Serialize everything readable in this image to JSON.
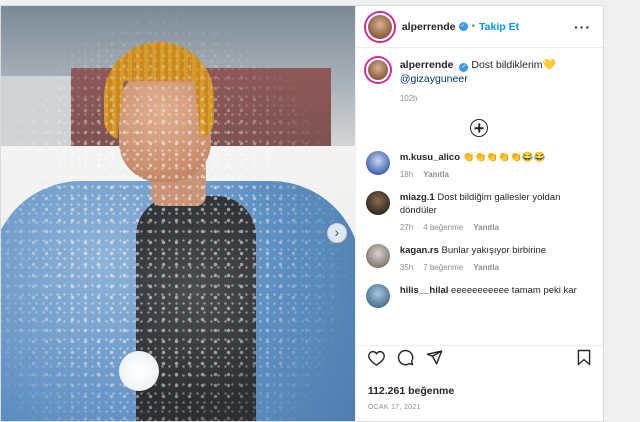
{
  "header": {
    "username": "alperrende",
    "follow_label": "Takip Et"
  },
  "caption": {
    "username": "alperrende",
    "text": "Dost bildiklerim💛",
    "mention": "@gizayguneer",
    "time": "102h"
  },
  "comments": [
    {
      "username": "m.kusu_alico",
      "text": "👏👏👏👏👏😂😂",
      "time": "18h",
      "likes": "",
      "reply": "Yanıtla"
    },
    {
      "username": "miazg.1",
      "text": "Dost bildiğim gallesler yoldan döndüler",
      "time": "27h",
      "likes": "4 beğenme",
      "reply": "Yanıtla"
    },
    {
      "username": "kagan.rs",
      "text": "Bunlar yakışıyor birbirine",
      "time": "35h",
      "likes": "7 beğenme",
      "reply": "Yanıtla"
    },
    {
      "username": "hilis__hilal",
      "text": "eeeeeeeeeee tamam peki kar",
      "time": "",
      "likes": "",
      "reply": ""
    }
  ],
  "likes": "112.261 beğenme",
  "date": "OCAK 17, 2021",
  "icons": {
    "next": "chevron-right-icon",
    "add": "plus-circle-icon",
    "like": "heart-icon",
    "comment": "comment-icon",
    "share": "paper-plane-icon",
    "save": "bookmark-icon",
    "verified": "verified-badge-icon",
    "more": "ellipsis-icon"
  },
  "colors": {
    "accent": "#0095f6",
    "verified": "#3897f0",
    "story_ring": "#d6249f"
  }
}
